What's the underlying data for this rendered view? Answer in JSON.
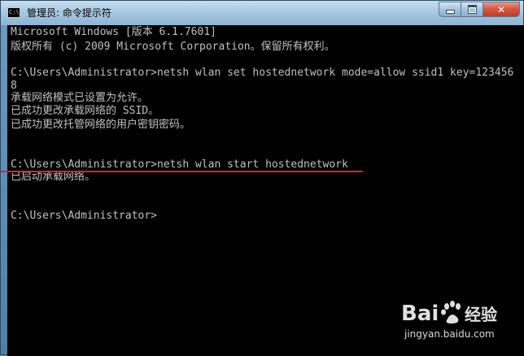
{
  "window": {
    "title": "管理员: 命令提示符",
    "icon_label": "C:\\",
    "buttons": {
      "minimize": "minimize-icon",
      "maximize": "maximize-icon",
      "close": "close-icon",
      "close_glyph": "✕"
    }
  },
  "console": {
    "lines": [
      "Microsoft Windows [版本 6.1.7601]",
      "版权所有 (c) 2009 Microsoft Corporation。保留所有权利。",
      "",
      "C:\\Users\\Administrator>netsh wlan set hostednetwork mode=allow ssid1 key=123456",
      "8",
      "承载网络模式已设置为允许。",
      "已成功更改承载网络的 SSID。",
      "已成功更改托管网络的用户密钥密码。",
      "",
      "",
      "C:\\Users\\Administrator>netsh wlan start hostednetwork",
      "已启动承载网络。",
      "",
      "",
      "C:\\Users\\Administrator>"
    ]
  },
  "watermark": {
    "brand": "Bai 经验",
    "url": "jingyan.baidu.com"
  },
  "colors": {
    "console_bg": "#000000",
    "console_text": "#c0c0c0",
    "highlight_underline": "#e0202a",
    "close_button": "#c23b22"
  }
}
